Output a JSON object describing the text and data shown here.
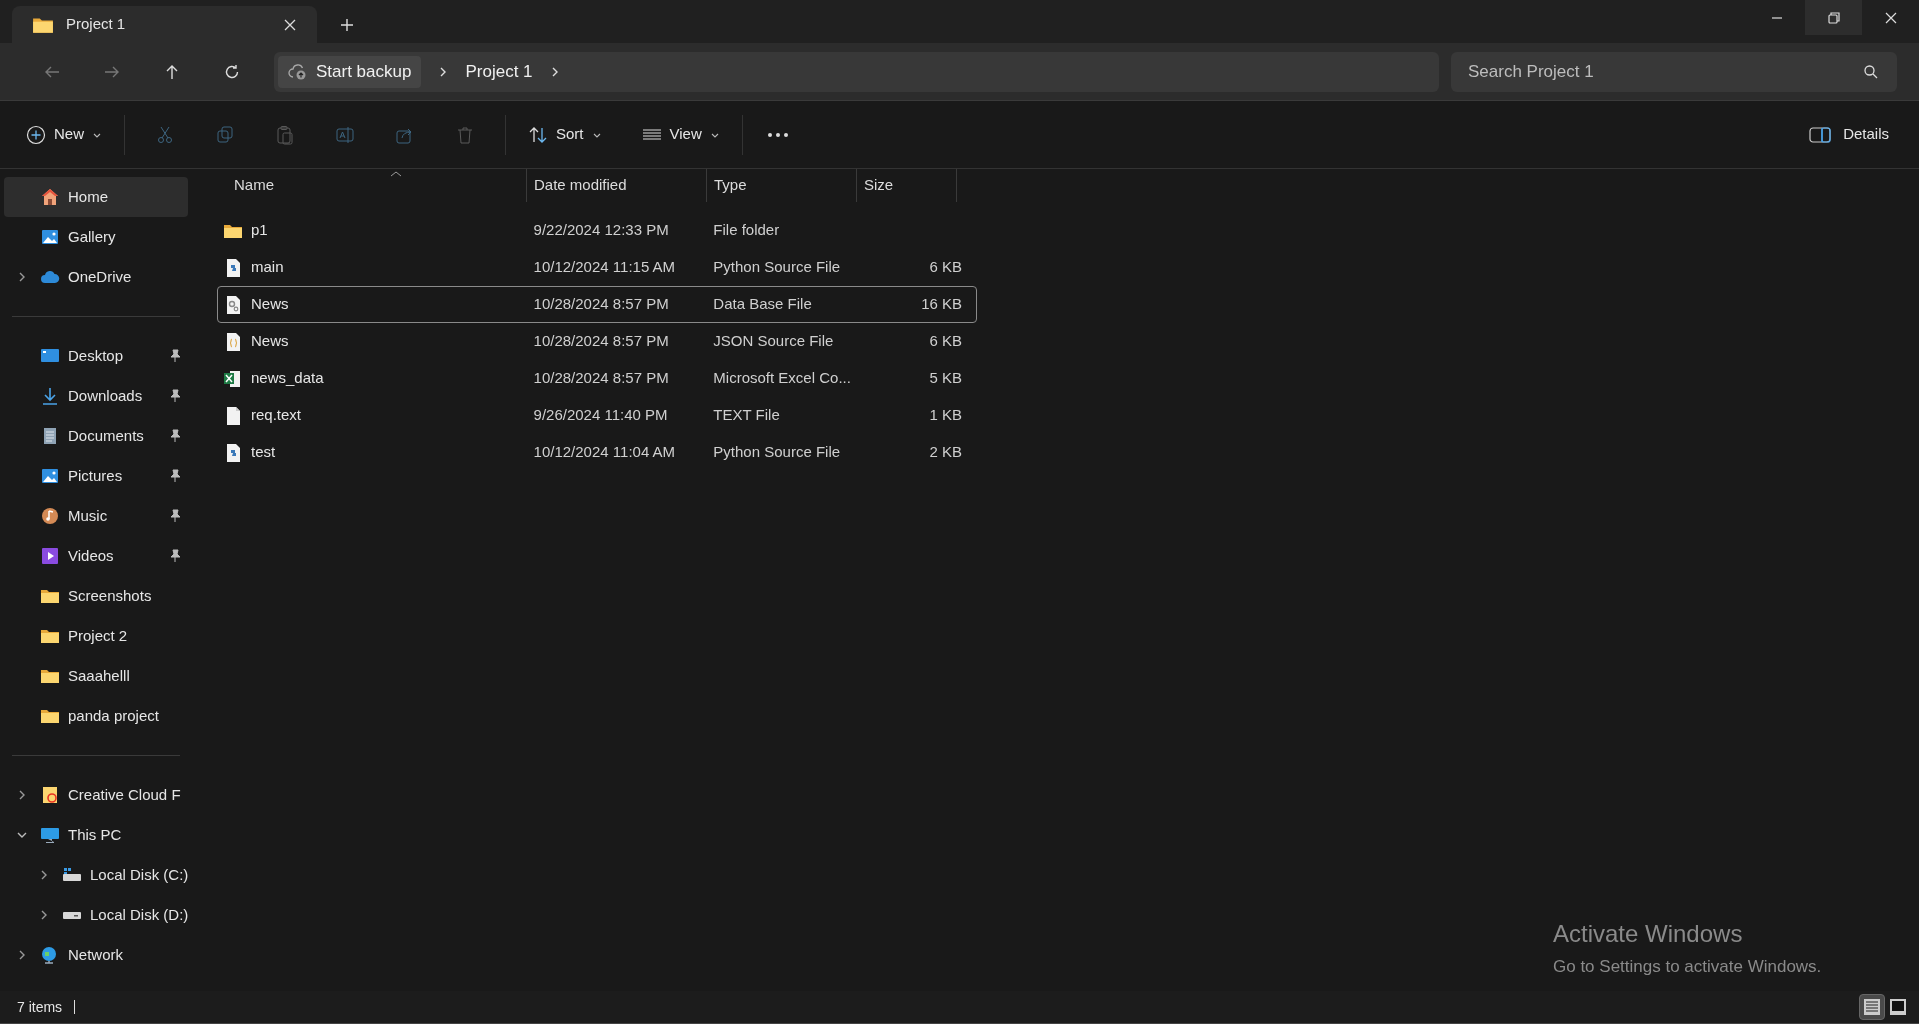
{
  "tabs": [
    {
      "title": "Project 1",
      "kind": "folder",
      "selected": true
    }
  ],
  "address_bar": {
    "backup": "Start backup",
    "breadcrumbs": [
      "Project 1"
    ]
  },
  "search": {
    "placeholder": "Search Project 1"
  },
  "toolbar": {
    "new": "New",
    "sort": "Sort",
    "view": "View",
    "details": "Details",
    "actions": [
      {
        "kind": "cut",
        "disabled": true
      },
      {
        "kind": "copy",
        "disabled": true
      },
      {
        "kind": "paste",
        "disabled": true
      },
      {
        "kind": "rename",
        "disabled": true
      },
      {
        "kind": "share",
        "disabled": true
      },
      {
        "kind": "delete",
        "disabled": true
      }
    ]
  },
  "sidebar": {
    "groups": [
      [
        {
          "label": "Home",
          "kind": "home",
          "selected": true
        },
        {
          "label": "Gallery",
          "kind": "gallery",
          "selected": false
        },
        {
          "label": "OneDrive",
          "kind": "cloud",
          "selected": false,
          "expanded": false
        }
      ],
      [
        {
          "label": "Desktop",
          "kind": "desktop",
          "selected": false,
          "pinned": true
        },
        {
          "label": "Downloads",
          "kind": "download",
          "selected": false,
          "pinned": true
        },
        {
          "label": "Documents",
          "kind": "document",
          "selected": false,
          "pinned": true
        },
        {
          "label": "Pictures",
          "kind": "gallery",
          "selected": false,
          "pinned": true
        },
        {
          "label": "Music",
          "kind": "music",
          "selected": false,
          "pinned": true
        },
        {
          "label": "Videos",
          "kind": "video",
          "selected": false,
          "pinned": true
        },
        {
          "label": "Screenshots",
          "kind": "folder",
          "selected": false
        },
        {
          "label": "Project 2",
          "kind": "folder",
          "selected": false
        },
        {
          "label": "Saaahelll",
          "kind": "folder",
          "selected": false
        },
        {
          "label": "panda project",
          "kind": "folder",
          "selected": false
        }
      ],
      [
        {
          "label": "Creative Cloud F",
          "kind": "ccfolder",
          "selected": false,
          "expanded": false
        },
        {
          "label": "This PC",
          "kind": "pc",
          "selected": false,
          "expanded": true,
          "children": [
            {
              "label": "Local Disk (C:)",
              "kind": "diskc",
              "selected": false,
              "expanded": false
            },
            {
              "label": "Local Disk (D:)",
              "kind": "disk",
              "selected": false,
              "expanded": false
            }
          ]
        },
        {
          "label": "Network",
          "kind": "network",
          "selected": false,
          "expanded": false
        }
      ]
    ]
  },
  "table": {
    "columns": [
      "Name",
      "Date modified",
      "Type",
      "Size"
    ],
    "rows": [
      {
        "kind": "folder",
        "name": "p1",
        "date": "9/22/2024 12:33 PM",
        "type": "File folder",
        "selected": false
      },
      {
        "kind": "python",
        "name": "main",
        "date": "10/12/2024 11:15 AM",
        "type": "Python Source File",
        "size": "6 KB",
        "selected": false
      },
      {
        "kind": "db",
        "name": "News",
        "date": "10/28/2024 8:57 PM",
        "type": "Data Base File",
        "size": "16 KB",
        "selected": true
      },
      {
        "kind": "json",
        "name": "News",
        "date": "10/28/2024 8:57 PM",
        "type": "JSON Source File",
        "size": "6 KB",
        "selected": false
      },
      {
        "kind": "excel",
        "name": "news_data",
        "date": "10/28/2024 8:57 PM",
        "type": "Microsoft Excel Co...",
        "size": "5 KB",
        "selected": false
      },
      {
        "kind": "text",
        "name": "req.text",
        "date": "9/26/2024 11:40 PM",
        "type": "TEXT File",
        "size": "1 KB",
        "selected": false
      },
      {
        "kind": "python",
        "name": "test",
        "date": "10/12/2024 11:04 AM",
        "type": "Python Source File",
        "size": "2 KB",
        "selected": false
      }
    ]
  },
  "status_bar": {
    "count": "7 items",
    "views": [
      {
        "kind": "details",
        "selected": true
      },
      {
        "kind": "tiles",
        "selected": false
      }
    ]
  },
  "activation": {
    "title": "Activate Windows",
    "text": "Go to Settings to activate Windows."
  }
}
